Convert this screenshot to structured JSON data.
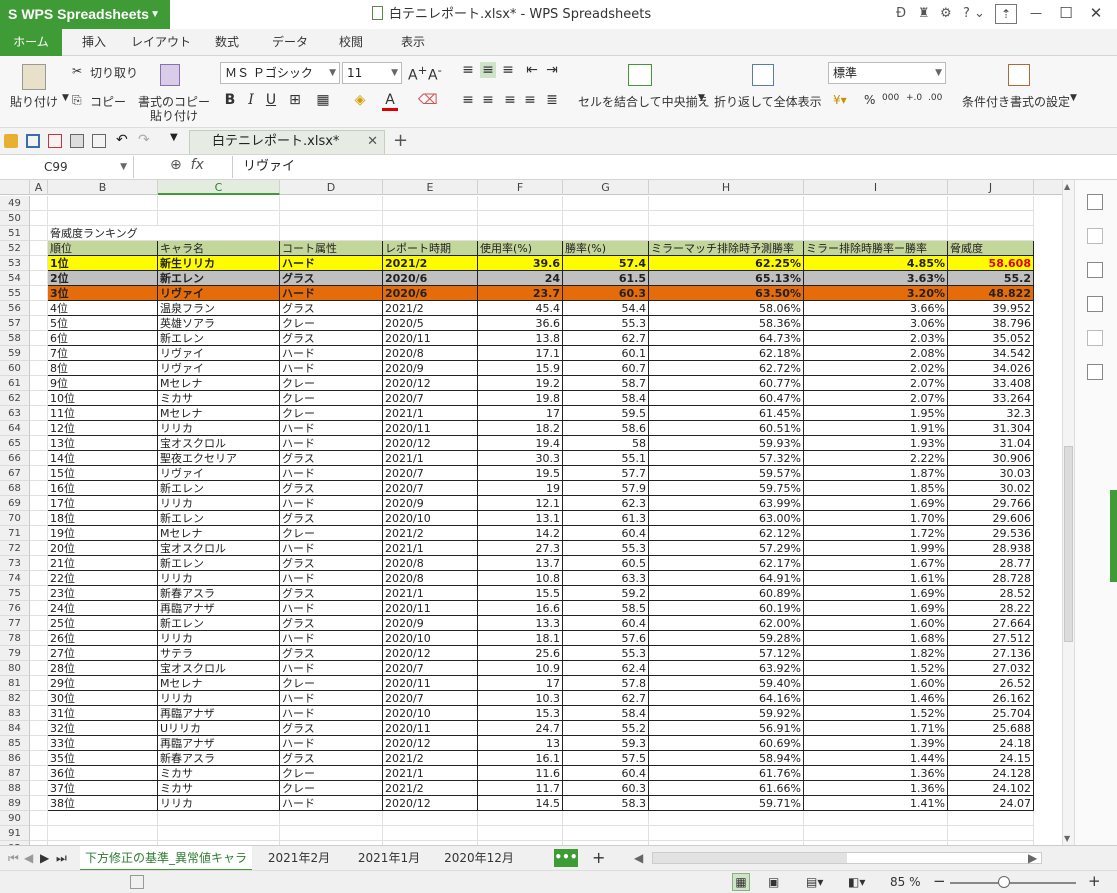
{
  "titlebar": {
    "app_name": "WPS Spreadsheets",
    "window_title": "白テニレポート.xlsx* - WPS Spreadsheets",
    "minimize": "—",
    "maximize": "☐",
    "close": "✕"
  },
  "ribbon_tabs": [
    "ホーム",
    "挿入",
    "レイアウト",
    "数式",
    "データ",
    "校閲",
    "表示"
  ],
  "ribbon": {
    "paste": "貼り付け",
    "cut": "切り取り",
    "copy": "コピー",
    "format_painter": "書式のコピー",
    "format_painter2": "貼り付け",
    "font_name": "ＭＳ Ｐゴシック",
    "font_size": "11",
    "merge_center": "セルを結合して中央揃え",
    "wrap_text": "折り返して全体表示",
    "number_format": "標準",
    "conditional_format": "条件付き書式の設定",
    "percent": "%"
  },
  "doc_tab": "白テニレポート.xlsx*",
  "formula_bar": {
    "name_box": "C99",
    "fx": "fx",
    "content": "リヴァイ"
  },
  "columns": [
    "A",
    "B",
    "C",
    "D",
    "E",
    "F",
    "G",
    "H",
    "I",
    "J"
  ],
  "empty_rows": [
    "49",
    "50",
    "90",
    "91",
    "92"
  ],
  "title_cell": {
    "row": "51",
    "text": "脅威度ランキング"
  },
  "header": {
    "row": "52",
    "cells": [
      "順位",
      "キャラ名",
      "コート属性",
      "レポート時期",
      "使用率(%)",
      "勝率(%)",
      "ミラーマッチ排除時予測勝率",
      "ミラー排除時勝率ー勝率",
      "脅威度"
    ]
  },
  "rows": [
    {
      "n": "53",
      "c": [
        "1位",
        "新生リリカ",
        "ハード",
        "2021/2",
        "39.6",
        "57.4",
        "62.25%",
        "4.85%",
        "58.608"
      ]
    },
    {
      "n": "54",
      "c": [
        "2位",
        "新エレン",
        "グラス",
        "2020/6",
        "24",
        "61.5",
        "65.13%",
        "3.63%",
        "55.2"
      ]
    },
    {
      "n": "55",
      "c": [
        "3位",
        "リヴァイ",
        "ハード",
        "2020/6",
        "23.7",
        "60.3",
        "63.50%",
        "3.20%",
        "48.822"
      ]
    },
    {
      "n": "56",
      "c": [
        "4位",
        "温泉フラン",
        "グラス",
        "2021/2",
        "45.4",
        "54.4",
        "58.06%",
        "3.66%",
        "39.952"
      ]
    },
    {
      "n": "57",
      "c": [
        "5位",
        "英雄ソアラ",
        "クレー",
        "2020/5",
        "36.6",
        "55.3",
        "58.36%",
        "3.06%",
        "38.796"
      ]
    },
    {
      "n": "58",
      "c": [
        "6位",
        "新エレン",
        "グラス",
        "2020/11",
        "13.8",
        "62.7",
        "64.73%",
        "2.03%",
        "35.052"
      ]
    },
    {
      "n": "59",
      "c": [
        "7位",
        "リヴァイ",
        "ハード",
        "2020/8",
        "17.1",
        "60.1",
        "62.18%",
        "2.08%",
        "34.542"
      ]
    },
    {
      "n": "60",
      "c": [
        "8位",
        "リヴァイ",
        "ハード",
        "2020/9",
        "15.9",
        "60.7",
        "62.72%",
        "2.02%",
        "34.026"
      ]
    },
    {
      "n": "61",
      "c": [
        "9位",
        "Mセレナ",
        "クレー",
        "2020/12",
        "19.2",
        "58.7",
        "60.77%",
        "2.07%",
        "33.408"
      ]
    },
    {
      "n": "62",
      "c": [
        "10位",
        "ミカサ",
        "クレー",
        "2020/7",
        "19.8",
        "58.4",
        "60.47%",
        "2.07%",
        "33.264"
      ]
    },
    {
      "n": "63",
      "c": [
        "11位",
        "Mセレナ",
        "クレー",
        "2021/1",
        "17",
        "59.5",
        "61.45%",
        "1.95%",
        "32.3"
      ]
    },
    {
      "n": "64",
      "c": [
        "12位",
        "リリカ",
        "ハード",
        "2020/11",
        "18.2",
        "58.6",
        "60.51%",
        "1.91%",
        "31.304"
      ]
    },
    {
      "n": "65",
      "c": [
        "13位",
        "宝オスクロル",
        "ハード",
        "2020/12",
        "19.4",
        "58",
        "59.93%",
        "1.93%",
        "31.04"
      ]
    },
    {
      "n": "66",
      "c": [
        "14位",
        "聖夜エクセリア",
        "グラス",
        "2021/1",
        "30.3",
        "55.1",
        "57.32%",
        "2.22%",
        "30.906"
      ]
    },
    {
      "n": "67",
      "c": [
        "15位",
        "リヴァイ",
        "ハード",
        "2020/7",
        "19.5",
        "57.7",
        "59.57%",
        "1.87%",
        "30.03"
      ]
    },
    {
      "n": "68",
      "c": [
        "16位",
        "新エレン",
        "グラス",
        "2020/7",
        "19",
        "57.9",
        "59.75%",
        "1.85%",
        "30.02"
      ]
    },
    {
      "n": "69",
      "c": [
        "17位",
        "リリカ",
        "ハード",
        "2020/9",
        "12.1",
        "62.3",
        "63.99%",
        "1.69%",
        "29.766"
      ]
    },
    {
      "n": "70",
      "c": [
        "18位",
        "新エレン",
        "グラス",
        "2020/10",
        "13.1",
        "61.3",
        "63.00%",
        "1.70%",
        "29.606"
      ]
    },
    {
      "n": "71",
      "c": [
        "19位",
        "Mセレナ",
        "クレー",
        "2021/2",
        "14.2",
        "60.4",
        "62.12%",
        "1.72%",
        "29.536"
      ]
    },
    {
      "n": "72",
      "c": [
        "20位",
        "宝オスクロル",
        "ハード",
        "2021/1",
        "27.3",
        "55.3",
        "57.29%",
        "1.99%",
        "28.938"
      ]
    },
    {
      "n": "73",
      "c": [
        "21位",
        "新エレン",
        "グラス",
        "2020/8",
        "13.7",
        "60.5",
        "62.17%",
        "1.67%",
        "28.77"
      ]
    },
    {
      "n": "74",
      "c": [
        "22位",
        "リリカ",
        "ハード",
        "2020/8",
        "10.8",
        "63.3",
        "64.91%",
        "1.61%",
        "28.728"
      ]
    },
    {
      "n": "75",
      "c": [
        "23位",
        "新春アスラ",
        "グラス",
        "2021/1",
        "15.5",
        "59.2",
        "60.89%",
        "1.69%",
        "28.52"
      ]
    },
    {
      "n": "76",
      "c": [
        "24位",
        "再臨アナザ",
        "ハード",
        "2020/11",
        "16.6",
        "58.5",
        "60.19%",
        "1.69%",
        "28.22"
      ]
    },
    {
      "n": "77",
      "c": [
        "25位",
        "新エレン",
        "グラス",
        "2020/9",
        "13.3",
        "60.4",
        "62.00%",
        "1.60%",
        "27.664"
      ]
    },
    {
      "n": "78",
      "c": [
        "26位",
        "リリカ",
        "ハード",
        "2020/10",
        "18.1",
        "57.6",
        "59.28%",
        "1.68%",
        "27.512"
      ]
    },
    {
      "n": "79",
      "c": [
        "27位",
        "サテラ",
        "グラス",
        "2020/12",
        "25.6",
        "55.3",
        "57.12%",
        "1.82%",
        "27.136"
      ]
    },
    {
      "n": "80",
      "c": [
        "28位",
        "宝オスクロル",
        "ハード",
        "2020/7",
        "10.9",
        "62.4",
        "63.92%",
        "1.52%",
        "27.032"
      ]
    },
    {
      "n": "81",
      "c": [
        "29位",
        "Mセレナ",
        "クレー",
        "2020/11",
        "17",
        "57.8",
        "59.40%",
        "1.60%",
        "26.52"
      ]
    },
    {
      "n": "82",
      "c": [
        "30位",
        "リリカ",
        "ハード",
        "2020/7",
        "10.3",
        "62.7",
        "64.16%",
        "1.46%",
        "26.162"
      ]
    },
    {
      "n": "83",
      "c": [
        "31位",
        "再臨アナザ",
        "ハード",
        "2020/10",
        "15.3",
        "58.4",
        "59.92%",
        "1.52%",
        "25.704"
      ]
    },
    {
      "n": "84",
      "c": [
        "32位",
        "Uリリカ",
        "グラス",
        "2020/11",
        "24.7",
        "55.2",
        "56.91%",
        "1.71%",
        "25.688"
      ]
    },
    {
      "n": "85",
      "c": [
        "33位",
        "再臨アナザ",
        "ハード",
        "2020/12",
        "13",
        "59.3",
        "60.69%",
        "1.39%",
        "24.18"
      ]
    },
    {
      "n": "86",
      "c": [
        "35位",
        "新春アスラ",
        "グラス",
        "2021/2",
        "16.1",
        "57.5",
        "58.94%",
        "1.44%",
        "24.15"
      ]
    },
    {
      "n": "87",
      "c": [
        "36位",
        "ミカサ",
        "クレー",
        "2021/1",
        "11.6",
        "60.4",
        "61.76%",
        "1.36%",
        "24.128"
      ]
    },
    {
      "n": "88",
      "c": [
        "37位",
        "ミカサ",
        "クレー",
        "2021/2",
        "11.7",
        "60.3",
        "61.66%",
        "1.36%",
        "24.102"
      ]
    },
    {
      "n": "89",
      "c": [
        "38位",
        "リリカ",
        "ハード",
        "2020/12",
        "14.5",
        "58.3",
        "59.71%",
        "1.41%",
        "24.07"
      ]
    }
  ],
  "sheet_tabs": [
    "下方修正の基準_異常値キャラ",
    "2021年2月",
    "2021年1月",
    "2020年12月"
  ],
  "sheet_more": "•••",
  "status": {
    "zoom": "85 %"
  }
}
